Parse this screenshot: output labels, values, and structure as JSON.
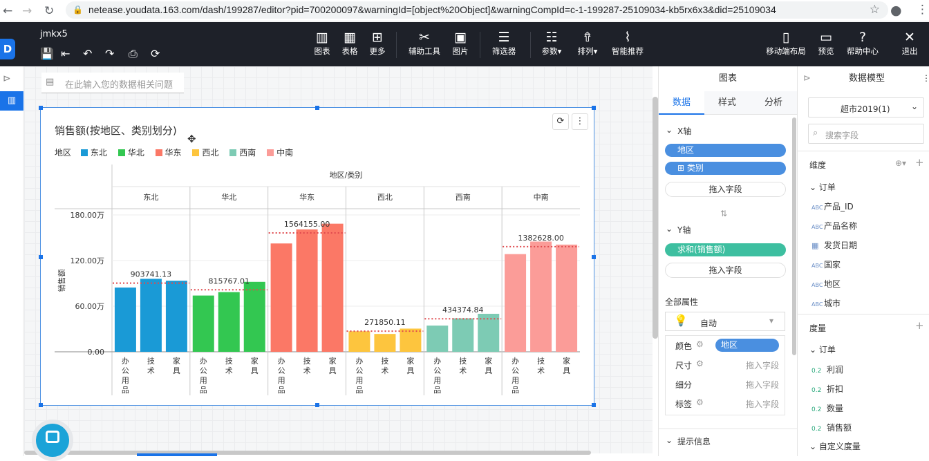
{
  "browser": {
    "url": "netease.youdata.163.com/dash/199287/editor?pid=700200097&warningId=[object%20Object]&warningCompId=c-1-199287-25109034-kb5rx6x3&did=25109034"
  },
  "app": {
    "title": "jmkx5",
    "toolbar": {
      "chart": "图表",
      "table": "表格",
      "more": "更多",
      "tools": "辅助工具",
      "image": "图片",
      "filter": "筛选器",
      "params": "参数",
      "sort": "排列",
      "smart": "智能推荐",
      "mobile": "移动端布局",
      "preview": "预览",
      "help": "帮助中心",
      "exit": "退出"
    }
  },
  "question_placeholder": "在此输入您的数据相关问题",
  "widget": {
    "title": "销售额(按地区、类别划分)",
    "legend_title": "地区",
    "legend": [
      {
        "name": "东北",
        "color": "#1a9ad6"
      },
      {
        "name": "华北",
        "color": "#33c751"
      },
      {
        "name": "华东",
        "color": "#fb7866"
      },
      {
        "name": "西北",
        "color": "#fdc53e"
      },
      {
        "name": "西南",
        "color": "#7dcbb4"
      },
      {
        "name": "中南",
        "color": "#fb9c98"
      }
    ]
  },
  "chart_data": {
    "type": "bar",
    "title": "销售额(按地区、类别划分)",
    "header_label": "地区/类别",
    "ylabel": "销售额",
    "ylim": [
      0,
      2000000
    ],
    "yticks": [
      0,
      600000,
      1200000,
      1800000
    ],
    "ytick_labels": [
      "0.00",
      "60.00万",
      "120.00万",
      "180.00万"
    ],
    "categories": [
      "办公用品",
      "技术",
      "家具"
    ],
    "groups": [
      {
        "name": "东北",
        "color": "#1a9ad6",
        "values": [
          845000,
          960000,
          935000
        ],
        "avg": 903741.13,
        "avg_label": "903741.13"
      },
      {
        "name": "华北",
        "color": "#33c751",
        "values": [
          740000,
          785000,
          920000
        ],
        "avg": 815767.01,
        "avg_label": "815767.01"
      },
      {
        "name": "华东",
        "color": "#fb7866",
        "values": [
          1425000,
          1610000,
          1685000
        ],
        "avg": 1564155.0,
        "avg_label": "1564155.00"
      },
      {
        "name": "西北",
        "color": "#fdc53e",
        "values": [
          270000,
          235000,
          305000
        ],
        "avg": 271850.11,
        "avg_label": "271850.11"
      },
      {
        "name": "西南",
        "color": "#7dcbb4",
        "values": [
          345000,
          440000,
          500000
        ],
        "avg": 434374.84,
        "avg_label": "434374.84"
      },
      {
        "name": "中南",
        "color": "#fb9c98",
        "values": [
          1285000,
          1450000,
          1410000
        ],
        "avg": 1382628.0,
        "avg_label": "1382628.00"
      }
    ]
  },
  "panel_chart": {
    "title": "图表",
    "tabs": [
      "数据",
      "样式",
      "分析"
    ],
    "x_axis_label": "X轴",
    "x_fields": [
      "地区",
      "⊞ 类别"
    ],
    "drop_label": "拖入字段",
    "y_axis_label": "Y轴",
    "y_fields": [
      "求和(销售额)"
    ],
    "all_props": "全部属性",
    "auto_label": "自动",
    "props": [
      {
        "name": "颜色",
        "value": "地区"
      },
      {
        "name": "尺寸",
        "value": "拖入字段"
      },
      {
        "name": "细分",
        "value": "拖入字段"
      },
      {
        "name": "标签",
        "value": "拖入字段"
      }
    ],
    "tooltip_label": "提示信息"
  },
  "panel_model": {
    "title": "数据模型",
    "dataset": "超市2019(1)",
    "search_placeholder": "搜索字段",
    "dimensions_label": "维度",
    "dim_group": "订单",
    "dim_fields": [
      {
        "type": "ABC",
        "name": "产品_ID"
      },
      {
        "type": "ABC",
        "name": "产品名称"
      },
      {
        "type": "date",
        "name": "发货日期"
      },
      {
        "type": "ABC",
        "name": "国家"
      },
      {
        "type": "ABC",
        "name": "地区"
      },
      {
        "type": "ABC",
        "name": "城市"
      }
    ],
    "measures_label": "度量",
    "measure_group": "订单",
    "measure_fields": [
      {
        "type": "0.2",
        "name": "利润"
      },
      {
        "type": "0.2",
        "name": "折扣"
      },
      {
        "type": "0.2",
        "name": "数量"
      },
      {
        "type": "0.2",
        "name": "销售额"
      }
    ],
    "custom_measure": "自定义度量"
  }
}
